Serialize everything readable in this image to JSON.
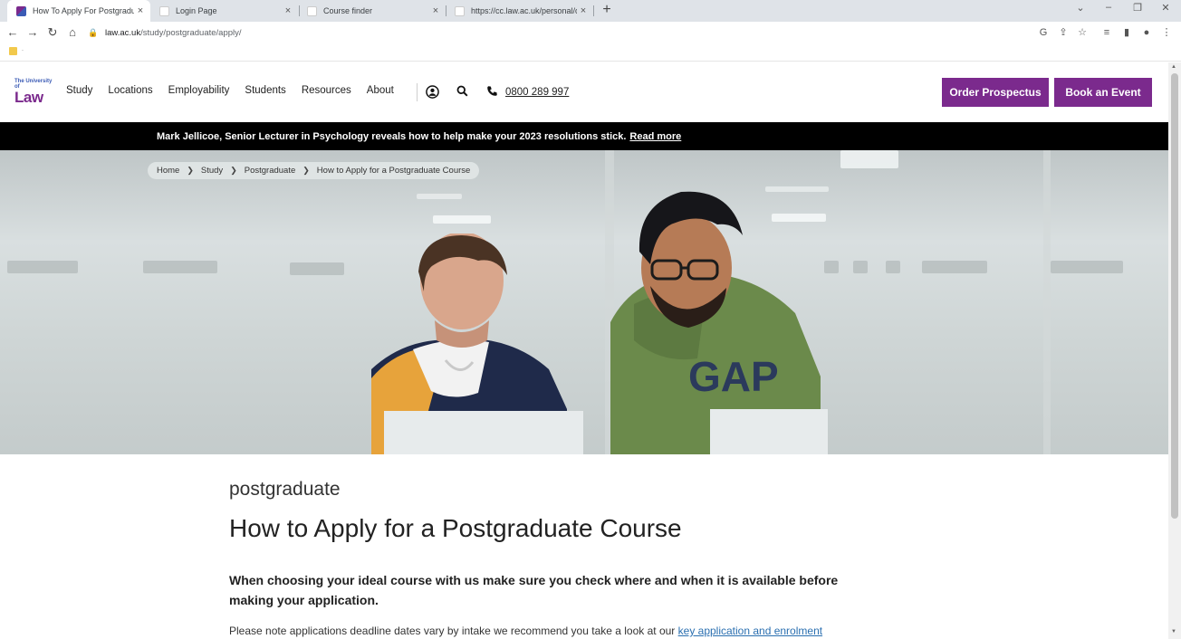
{
  "browser": {
    "tabs": [
      {
        "title": "How To Apply For Postgraduate C",
        "favicon": "law-logo-icon",
        "active": true
      },
      {
        "title": "Login Page",
        "favicon": "blank-page-icon",
        "active": false
      },
      {
        "title": "Course finder",
        "favicon": "blank-page-icon",
        "active": false
      },
      {
        "title": "https://cc.law.ac.uk/personal/cou",
        "favicon": "blank-page-icon",
        "active": false
      }
    ],
    "close_glyph": "×",
    "new_tab_glyph": "+",
    "url_host": "law.ac.uk",
    "url_path": "/study/postgraduate/apply/",
    "bookmark_folder_label": "."
  },
  "site": {
    "logo_small": "The University of",
    "logo_big": "Law",
    "nav": [
      "Study",
      "Locations",
      "Employability",
      "Students",
      "Resources",
      "About"
    ],
    "phone": "0800 289 997",
    "cta_prospectus": "Order Prospectus",
    "cta_event": "Book an Event",
    "brand_color": "#7b2a8d"
  },
  "announcement": {
    "text": "Mark Jellicoe, Senior Lecturer in Psychology reveals how to help make your 2023 resolutions stick.",
    "link": "Read more"
  },
  "breadcrumb": [
    "Home",
    "Study",
    "Postgraduate",
    "How to Apply for a Postgraduate Course"
  ],
  "content": {
    "eyebrow": "postgraduate",
    "title": "How to Apply for a Postgraduate Course",
    "lede": "When choosing your ideal course with us make sure you check where and when it is available before making your application.",
    "body_prefix": "Please note applications deadline dates vary by intake we recommend you take a look at our",
    "body_link": "key application and enrolment"
  }
}
